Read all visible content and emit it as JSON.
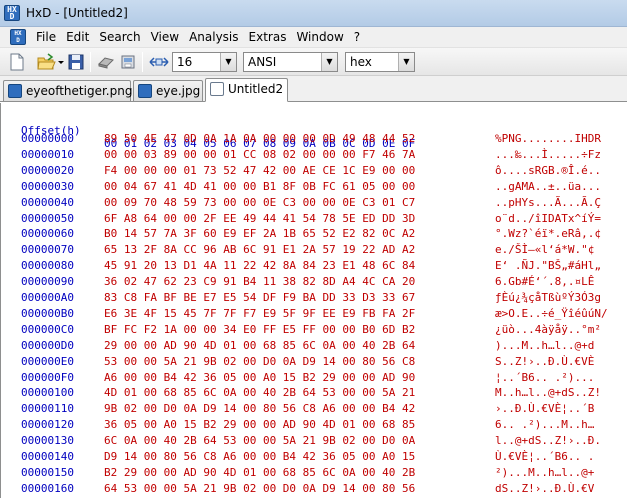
{
  "window": {
    "title": "HxD - [Untitled2]",
    "icon": "hxd-app-icon"
  },
  "menu": {
    "items": [
      "File",
      "Edit",
      "Search",
      "View",
      "Analysis",
      "Extras",
      "Window",
      "?"
    ]
  },
  "toolbar": {
    "bytes_per_row": "16",
    "charset": "ANSI",
    "offset_base": "hex"
  },
  "tabs": [
    {
      "label": "eyeofthetiger.png",
      "active": false
    },
    {
      "label": "eye.jpg",
      "active": false
    },
    {
      "label": "Untitled2",
      "active": true
    }
  ],
  "hex": {
    "offset_header": "Offset(h)",
    "column_header": "00 01 02 03 04 05 06 07 08 09 0A 0B 0C 0D 0E 0F",
    "rows": [
      {
        "offset": "00000000",
        "bytes": "89 50 4E 47 0D 0A 1A 0A 00 00 00 0D 49 48 44 52",
        "ascii": "%PNG........IHDR"
      },
      {
        "offset": "00000010",
        "bytes": "00 00 03 89 00 00 01 CC 08 02 00 00 00 F7 46 7A",
        "ascii": "...‰...Ì.....÷Fz"
      },
      {
        "offset": "00000020",
        "bytes": "F4 00 00 00 01 73 52 47 42 00 AE CE 1C E9 00 00",
        "ascii": "ô....sRGB.®Î.é.."
      },
      {
        "offset": "00000030",
        "bytes": "00 04 67 41 4D 41 00 00 B1 8F 0B FC 61 05 00 00",
        "ascii": "..gAMA..±..üa..."
      },
      {
        "offset": "00000040",
        "bytes": "00 09 70 48 59 73 00 00 0E C3 00 00 0E C3 01 C7",
        "ascii": "..pHYs...Ã...Ã.Ç"
      },
      {
        "offset": "00000050",
        "bytes": "6F A8 64 00 00 2F EE 49 44 41 54 78 5E ED DD 3D",
        "ascii": "o¨d../îIDATx^íÝ="
      },
      {
        "offset": "00000060",
        "bytes": "B0 14 57 7A 3F 60 E9 EF 2A 1B 65 52 E2 82 0C A2",
        "ascii": "°.Wz?`éï*.eRâ‚.¢"
      },
      {
        "offset": "00000070",
        "bytes": "65 13 2F 8A CC 96 AB 6C 91 E1 2A 57 19 22 AD A2",
        "ascii": "e./ŠÌ–«l‘á*W.\"­¢"
      },
      {
        "offset": "00000080",
        "bytes": "45 91 20 13 D1 4A 11 22 42 8A 84 23 E1 48 6C 84",
        "ascii": "E‘ .ÑJ.\"BŠ„#áHl„"
      },
      {
        "offset": "00000090",
        "bytes": "36 02 47 62 23 C9 91 B4 11 38 82 8D A4 4C CA 20",
        "ascii": "6.Gb#É‘´.8‚.¤LÊ "
      },
      {
        "offset": "000000A0",
        "bytes": "83 C8 FA BF BE E7 E5 54 DF F9 BA DD 33 D3 33 67",
        "ascii": "ƒÈú¿¾çåTßùºÝ3Ó3g"
      },
      {
        "offset": "000000B0",
        "bytes": "E6 3E 4F 15 45 7F 7F F7 E9 5F 9F EE E9 FB FA 2F",
        "ascii": "æ>O.E..÷é_ŸîéûúN/"
      },
      {
        "offset": "000000C0",
        "bytes": "BF FC F2 1A 00 00 34 E0 FF E5 FF 00 00 B0 6D B2",
        "ascii": "¿üò...4àÿåÿ..°m²"
      },
      {
        "offset": "000000D0",
        "bytes": "29 00 00 AD 90 4D 01 00 68 85 6C 0A 00 40 2B 64",
        "ascii": ")..­.M..h…l..@+d"
      },
      {
        "offset": "000000E0",
        "bytes": "53 00 00 5A 21 9B 02 00 D0 0A D9 14 00 80 56 C8",
        "ascii": "S..Z!›..Ð.Ù.€VÈ"
      },
      {
        "offset": "000000F0",
        "bytes": "A6 00 00 B4 42 36 05 00 A0 15 B2 29 00 00 AD 90",
        "ascii": "¦..´B6.. .²)..­."
      },
      {
        "offset": "00000100",
        "bytes": "4D 01 00 68 85 6C 0A 00 40 2B 64 53 00 00 5A 21",
        "ascii": "M..h…l..@+dS..Z!"
      },
      {
        "offset": "00000110",
        "bytes": "9B 02 00 D0 0A D9 14 00 80 56 C8 A6 00 00 B4 42",
        "ascii": "›..Ð.Ù.€VÈ¦..´B"
      },
      {
        "offset": "00000120",
        "bytes": "36 05 00 A0 15 B2 29 00 00 AD 90 4D 01 00 68 85",
        "ascii": "6.. .²)..­.M..h…"
      },
      {
        "offset": "00000130",
        "bytes": "6C 0A 00 40 2B 64 53 00 00 5A 21 9B 02 00 D0 0A",
        "ascii": "l..@+dS..Z!›..Ð."
      },
      {
        "offset": "00000140",
        "bytes": "D9 14 00 80 56 C8 A6 00 00 B4 42 36 05 00 A0 15",
        "ascii": "Ù.€VÈ¦..´B6.. ."
      },
      {
        "offset": "00000150",
        "bytes": "B2 29 00 00 AD 90 4D 01 00 68 85 6C 0A 00 40 2B",
        "ascii": "²)..­.M..h…l..@+"
      },
      {
        "offset": "00000160",
        "bytes": "64 53 00 00 5A 21 9B 02 00 D0 0A D9 14 00 80 56",
        "ascii": "dS..Z!›..Ð.Ù.€V"
      }
    ]
  }
}
